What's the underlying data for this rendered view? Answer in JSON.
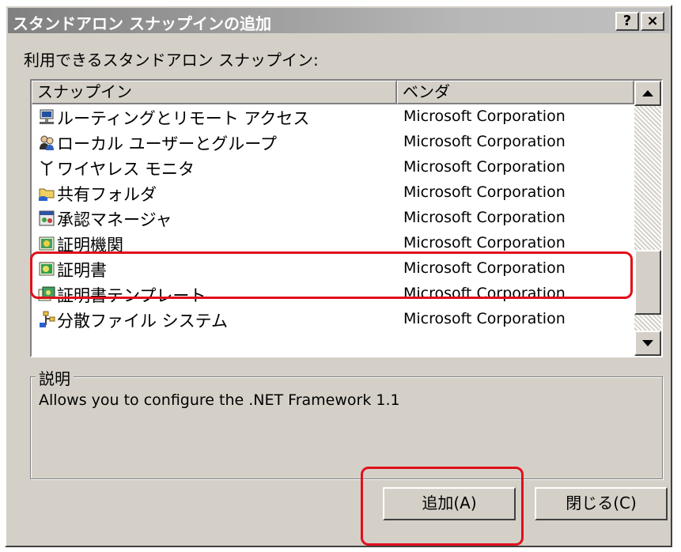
{
  "window": {
    "title": "スタンドアロン スナップインの追加",
    "help_label": "?",
    "close_label": "×"
  },
  "list": {
    "label": "利用できるスタンドアロン スナップイン:",
    "columns": {
      "name": "スナップイン",
      "vendor": "ベンダ"
    },
    "items": [
      {
        "name": "ルーティングとリモート アクセス",
        "vendor": "Microsoft Corporation",
        "icon": "routing-icon"
      },
      {
        "name": "ローカル ユーザーとグループ",
        "vendor": "Microsoft Corporation",
        "icon": "users-groups-icon"
      },
      {
        "name": "ワイヤレス モニタ",
        "vendor": "Microsoft Corporation",
        "icon": "antenna-icon"
      },
      {
        "name": "共有フォルダ",
        "vendor": "Microsoft Corporation",
        "icon": "shared-folder-icon"
      },
      {
        "name": "承認マネージャ",
        "vendor": "Microsoft Corporation",
        "icon": "authorization-manager-icon"
      },
      {
        "name": "証明機関",
        "vendor": "Microsoft Corporation",
        "icon": "certification-authority-icon"
      },
      {
        "name": "証明書",
        "vendor": "Microsoft Corporation",
        "icon": "certificate-icon"
      },
      {
        "name": "証明書テンプレート",
        "vendor": "Microsoft Corporation",
        "icon": "certificate-templates-icon"
      },
      {
        "name": "分散ファイル システム",
        "vendor": "Microsoft Corporation",
        "icon": "dfs-icon"
      }
    ]
  },
  "description": {
    "legend": "説明",
    "text": "Allows you to configure the .NET Framework 1.1"
  },
  "buttons": {
    "add": "追加(A)",
    "close": "閉じる(C)"
  },
  "colors": {
    "highlight": "#e0101c",
    "face": "#d4d0c8",
    "title_gradient_start": "#808080"
  }
}
